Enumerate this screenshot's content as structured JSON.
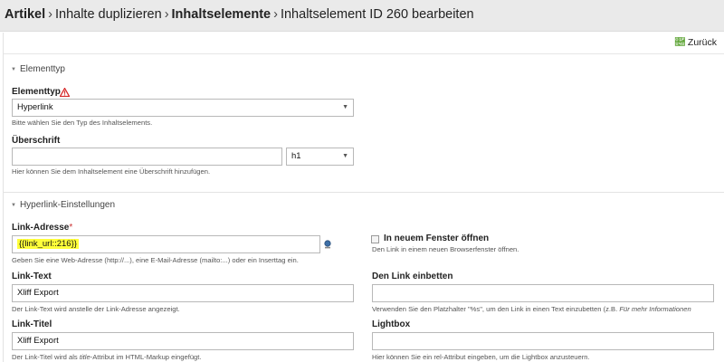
{
  "breadcrumb": {
    "items": [
      {
        "label": "Artikel",
        "bold": true
      },
      {
        "label": "Inhalte duplizieren",
        "bold": false
      },
      {
        "label": "Inhaltselemente",
        "bold": true
      },
      {
        "label": "Inhaltselement ID 260 bearbeiten",
        "bold": false
      }
    ],
    "separator": "›"
  },
  "back_link": {
    "label": "Zurück",
    "icon": "arrow-left-icon",
    "color": "#5fa537"
  },
  "sections": {
    "elementtyp": {
      "legend": "Elementtyp",
      "type_label": "Elementtyp",
      "type_value": "Hyperlink",
      "type_help": "Bitte wählen Sie den Typ des Inhaltselements.",
      "headline_label": "Überschrift",
      "headline_value": "",
      "headline_unit": "h1",
      "headline_help": "Hier können Sie dem Inhaltselement eine Überschrift hinzufügen."
    },
    "hyperlink": {
      "legend": "Hyperlink-Einstellungen",
      "url_label": "Link-Adresse",
      "url_required": "*",
      "url_value": "{{link_url::216}}",
      "url_help": "Geben Sie eine Web-Adresse (http://...), eine E-Mail-Adresse (mailto:...) oder ein Inserttag ein.",
      "target_label": "In neuem Fenster öffnen",
      "target_help": "Den Link in einem neuen Browserfenster öffnen.",
      "link_text_label": "Link-Text",
      "link_text_value": "Xliff Export",
      "link_text_help": "Der Link-Text wird anstelle der Link-Adresse angezeigt.",
      "embed_label": "Den Link einbetten",
      "embed_value": "",
      "embed_help": "Verwenden Sie den Platzhalter \"%s\", um den Link in einen Text einzubetten (z.B.",
      "embed_help_italic": "Für mehr Informationen",
      "link_title_label": "Link-Titel",
      "link_title_value": "Xliff Export",
      "link_title_help_pre": "Der Link-Titel wird als",
      "link_title_help_italic": "title",
      "link_title_help_post": "-Attribut im HTML-Markup eingefügt.",
      "lightbox_label": "Lightbox",
      "lightbox_value": "",
      "lightbox_help": "Hier können Sie ein rel-Attribut eingeben, um die Lightbox anzusteuern."
    }
  },
  "icons": {
    "collapse": "triangle-down-icon",
    "warning": "warning-icon",
    "picker": "pagepicker-icon",
    "select_caret": "caret-down-icon"
  },
  "colors": {
    "highlight": "#ffff3a",
    "required": "#cc3333",
    "warning": "#d62b2b",
    "topbar": "#eaeaea"
  }
}
